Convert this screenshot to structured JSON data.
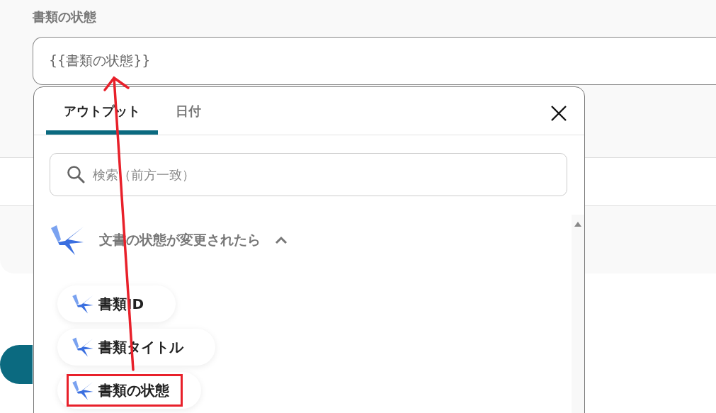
{
  "field": {
    "label": "書類の状態",
    "value": "{{書類の状態}}"
  },
  "panel": {
    "tabs": [
      {
        "label": "アウトプット",
        "selected": true
      },
      {
        "label": "日付",
        "selected": false
      }
    ],
    "search": {
      "placeholder": "検索（前方一致）"
    },
    "group": {
      "title": "文書の状態が変更されたら",
      "expanded": true,
      "items": [
        {
          "label": "書類ID",
          "highlighted": false
        },
        {
          "label": "書類タイトル",
          "highlighted": false
        },
        {
          "label": "書類の状態",
          "highlighted": true
        }
      ]
    }
  }
}
